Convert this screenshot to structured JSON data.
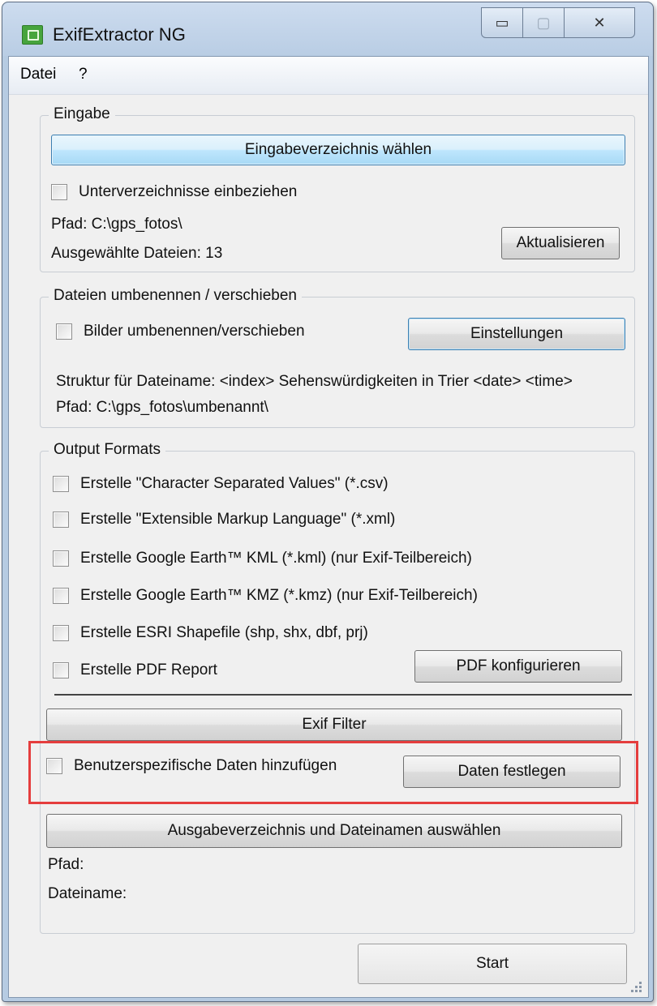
{
  "window": {
    "title": "ExifExtractor NG",
    "controls": {
      "minimize": "▭",
      "maximize": "▢",
      "close": "✕"
    }
  },
  "menu": [
    "Datei",
    "?"
  ],
  "input_group": {
    "title": "Eingabe",
    "choose_dir_button": "Eingabeverzeichnis wählen",
    "subdirs_checkbox": "Unterverzeichnisse einbeziehen",
    "path": "Pfad: C:\\gps_fotos\\",
    "selected_files": "Ausgewählte Dateien: 13",
    "refresh_button": "Aktualisieren"
  },
  "rename_group": {
    "title": "Dateien umbenennen / verschieben",
    "rename_checkbox": "Bilder umbenennen/verschieben",
    "settings_button": "Einstellungen",
    "structure": "Struktur für Dateiname: <index> Sehenswürdigkeiten in Trier <date> <time>",
    "path": "Pfad: C:\\gps_fotos\\umbenannt\\"
  },
  "output_group": {
    "title": "Output Formats",
    "options": [
      "Erstelle \"Character Separated Values\" (*.csv)",
      "Erstelle \"Extensible Markup Language\" (*.xml)",
      "Erstelle Google Earth™ KML (*.kml) (nur Exif-Teilbereich)",
      "Erstelle Google Earth™ KMZ (*.kmz) (nur Exif-Teilbereich)",
      "Erstelle ESRI Shapefile (shp, shx, dbf, prj)",
      "Erstelle PDF Report"
    ],
    "pdf_button": "PDF konfigurieren",
    "exif_filter_button": "Exif Filter",
    "custom_data_checkbox": "Benutzerspezifische Daten hinzufügen",
    "define_data_button": "Daten festlegen",
    "output_dir_button": "Ausgabeverzeichnis und Dateinamen auswählen",
    "path_label": "Pfad:",
    "filename_label": "Dateiname:"
  },
  "start_button": "Start",
  "colors": {
    "highlight": "#e53d3d",
    "titlebar": "#b9cde4",
    "accent_button": "#bee6fd"
  }
}
